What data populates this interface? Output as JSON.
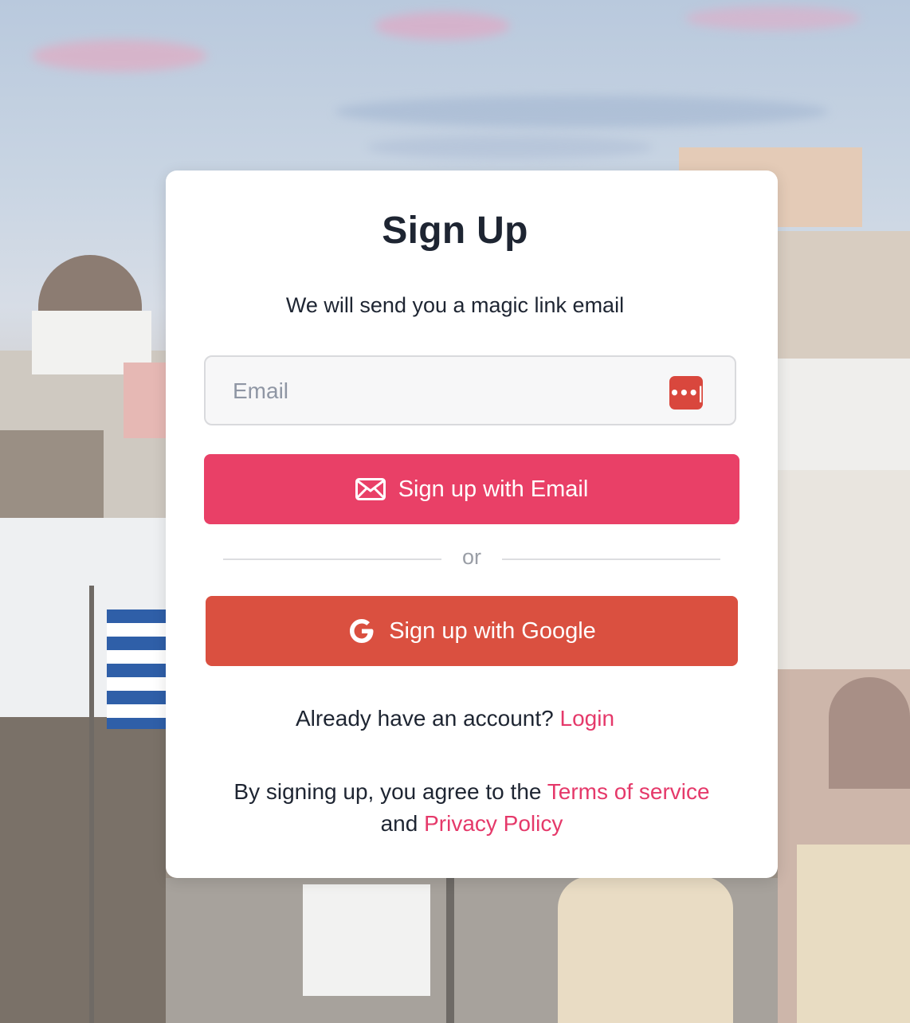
{
  "colors": {
    "primary": "#e94067",
    "google": "#da5040",
    "link": "#e5396a",
    "text": "#1e2532",
    "card": "#ffffff"
  },
  "signup": {
    "title": "Sign Up",
    "subtitle": "We will send you a magic link email",
    "email_placeholder": "Email",
    "email_value": "",
    "email_button_label": "Sign up with Email",
    "divider_text": "or",
    "google_button_label": "Sign up with Google",
    "login_prompt": "Already have an account?",
    "login_link": "Login",
    "terms_prefix": "By signing up, you agree to the",
    "terms_link": "Terms of service",
    "terms_and": "and",
    "privacy_link": "Privacy Policy"
  },
  "icons": {
    "password_manager": "password-manager-icon",
    "envelope": "envelope-icon",
    "google": "google-icon"
  }
}
